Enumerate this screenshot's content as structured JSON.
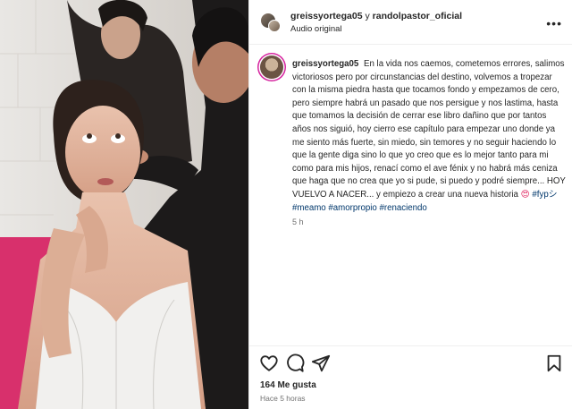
{
  "header": {
    "user1": "greissyortega05",
    "conjunction": "y",
    "user2": "randolpastor_oficial",
    "audio": "Audio original",
    "more_icon": "more-horizontal-icon"
  },
  "caption": {
    "username": "greissyortega05",
    "text": "En la vida nos caemos, cometemos errores, salimos victoriosos pero por circunstancias del destino, volvemos a tropezar con la misma piedra hasta que tocamos fondo y empezamos de cero, pero siempre habrá un pasado que nos persigue y nos lastima, hasta que tomamos la decisión de cerrar ese libro dañino que por tantos años nos siguió, hoy cierro ese capítulo para empezar uno donde ya me siento más fuerte, sin miedo, sin temores y no seguir haciendo lo que la gente diga sino lo que yo creo que es lo mejor tanto para mi como para mis hijos, renací como el ave fénix y no habrá más ceniza que haga que no crea que yo si pude, si puedo y podré siempre... HOY VUELVO A NACER... y empiezo a crear una nueva historia",
    "emoji": "😍",
    "tags": [
      "#fypシ",
      "#meamo",
      "#amorpropio",
      "#renaciendo"
    ],
    "time": "5 h"
  },
  "actions": {
    "like_icon": "heart-icon",
    "comment_icon": "comment-icon",
    "share_icon": "share-icon",
    "save_icon": "bookmark-icon",
    "likes": "164 Me gusta",
    "posted": "Hace 5 horas"
  }
}
